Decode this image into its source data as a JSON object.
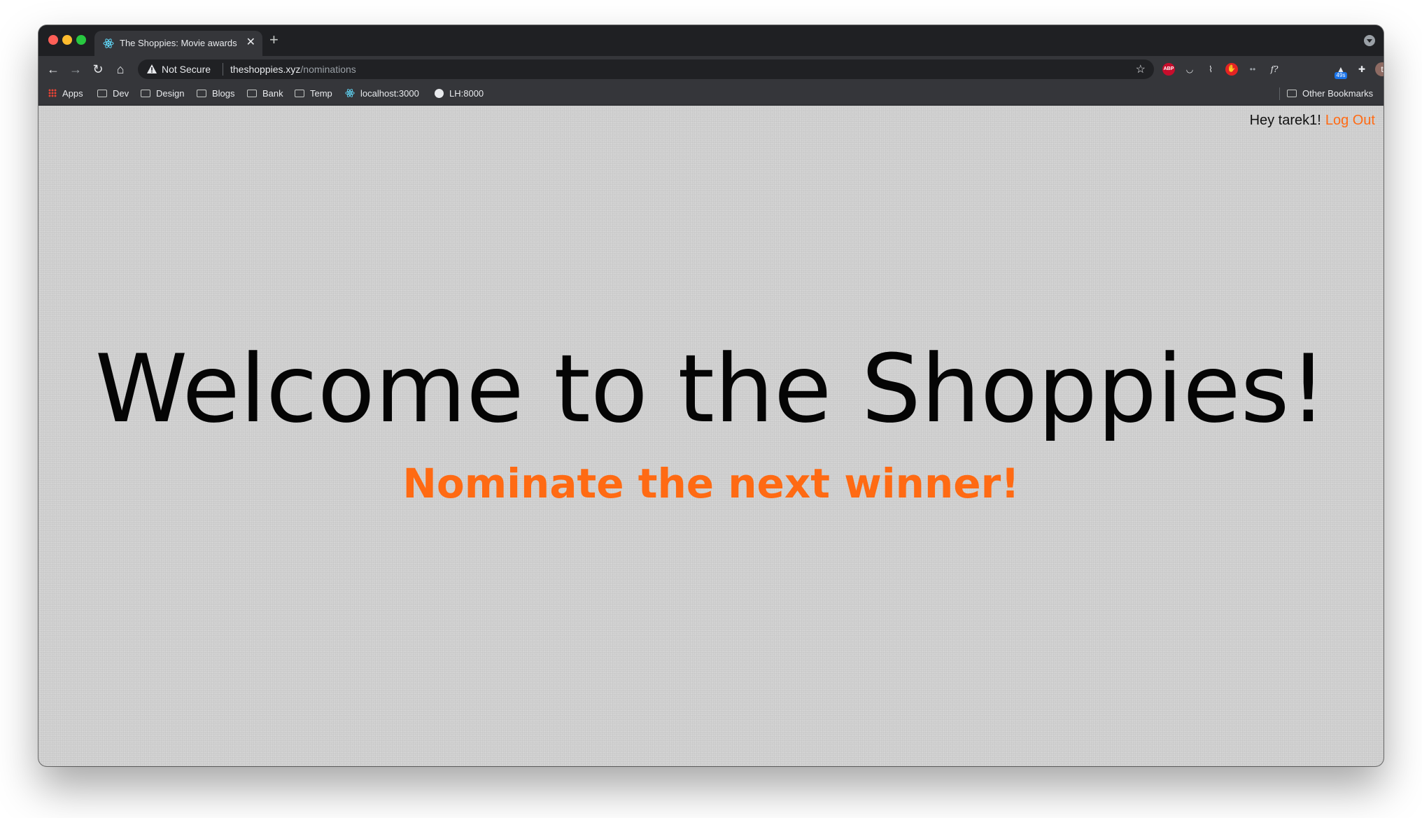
{
  "browser": {
    "tab_title": "The Shoppies: Movie awards for",
    "address": {
      "security_label": "Not Secure",
      "host": "theshoppies.xyz",
      "path": "/nominations"
    },
    "bookmarks": [
      {
        "label": "Apps",
        "icon": "apps-grid-icon"
      },
      {
        "label": "Dev",
        "icon": "folder-icon"
      },
      {
        "label": "Design",
        "icon": "folder-icon"
      },
      {
        "label": "Blogs",
        "icon": "folder-icon"
      },
      {
        "label": "Bank",
        "icon": "folder-icon"
      },
      {
        "label": "Temp",
        "icon": "folder-icon"
      },
      {
        "label": "localhost:3000",
        "icon": "react-icon"
      },
      {
        "label": "LH:8000",
        "icon": "globe-icon"
      }
    ],
    "other_bookmarks": "Other Bookmarks",
    "extensions": {
      "abp": "ABP",
      "function": "f?",
      "badge": "49s",
      "avatar": "t"
    }
  },
  "page": {
    "greeting": "Hey tarek1!",
    "logout": "Log Out",
    "headline": "Welcome to the Shoppies!",
    "subheadline": "Nominate the next winner!"
  },
  "colors": {
    "accent": "#ff6a13",
    "page_bg": "#d2d2d2",
    "headline": "#050505"
  }
}
